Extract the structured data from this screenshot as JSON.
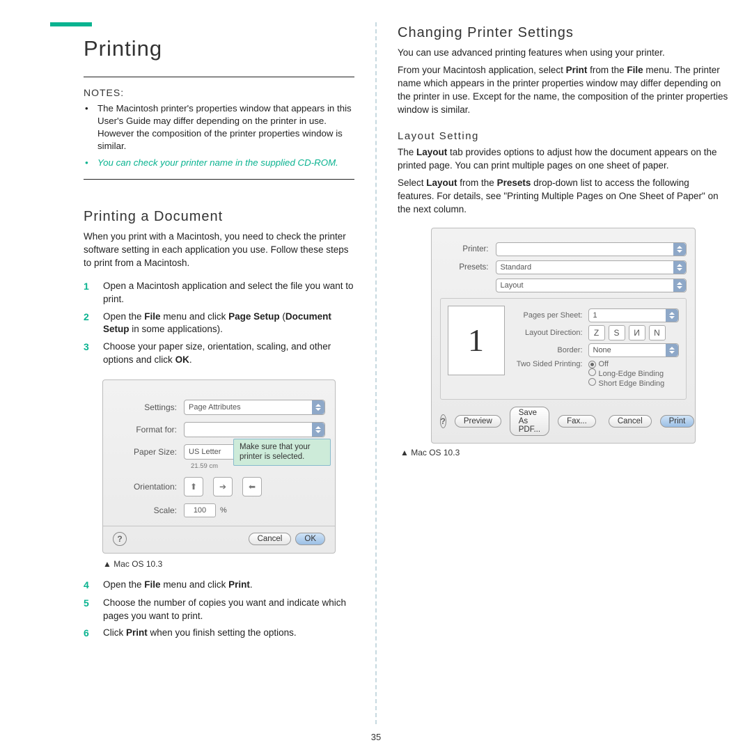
{
  "page_number": "35",
  "left": {
    "heading": "Printing",
    "notes_label": "NOTES:",
    "note1": "The Macintosh printer's properties window that appears in this User's Guide may differ depending on the printer in use. However the composition of the printer properties window is similar.",
    "note2": "You can check your printer name in the supplied CD-ROM.",
    "h2": "Printing a Document",
    "intro": "When you print with a Macintosh, you need to check the printer software setting in each application you use. Follow these steps to print from a Macintosh.",
    "steps": {
      "s1": "Open a Macintosh application and select the file you want to print.",
      "s2a": "Open the ",
      "s2b": "File",
      "s2c": " menu and click ",
      "s2d": "Page Setup",
      "s2e": " (",
      "s2f": "Document Setup",
      "s2g": " in some applications).",
      "s3a": "Choose your paper size, orientation, scaling, and other options and click ",
      "s3b": "OK",
      "s3c": ".",
      "s4a": "Open the ",
      "s4b": "File",
      "s4c": " menu and click ",
      "s4d": "Print",
      "s4e": ".",
      "s5": "Choose the number of copies you want and indicate which pages you want to print.",
      "s6a": "Click ",
      "s6b": "Print",
      "s6c": " when you finish setting the options."
    },
    "dialog1": {
      "settings_lbl": "Settings:",
      "settings_val": "Page Attributes",
      "format_lbl": "Format for:",
      "paper_lbl": "Paper Size:",
      "paper_val": "US Letter",
      "paper_sub": "21.59 cm",
      "orient_lbl": "Orientation:",
      "scale_lbl": "Scale:",
      "scale_val": "100",
      "scale_unit": "%",
      "callout": "Make sure that your printer is selected.",
      "cancel": "Cancel",
      "ok": "OK",
      "help": "?"
    },
    "figcap": "▲ Mac OS 10.3"
  },
  "right": {
    "h2": "Changing Printer Settings",
    "p1": "You can use advanced printing features when using your printer.",
    "p2a": "From your Macintosh application, select ",
    "p2b": "Print",
    "p2c": " from the ",
    "p2d": "File",
    "p2e": " menu. The printer name which appears in the printer properties window may differ depending on the printer in use. Except for the name, the composition of the printer properties window is similar.",
    "h3": "Layout Setting",
    "p3a": "The ",
    "p3b": "Layout",
    "p3c": " tab provides options to adjust how the document appears on the printed page. You can print multiple pages on one sheet of paper.",
    "p4a": "Select ",
    "p4b": "Layout",
    "p4c": " from the ",
    "p4d": "Presets",
    "p4e": " drop-down list to access the following features. For details, see \"Printing Multiple Pages on One Sheet of Paper\" on the next column.",
    "dialog2": {
      "printer_lbl": "Printer:",
      "presets_lbl": "Presets:",
      "presets_val": "Standard",
      "panel_val": "Layout",
      "pps_lbl": "Pages per Sheet:",
      "pps_val": "1",
      "ld_lbl": "Layout Direction:",
      "border_lbl": "Border:",
      "border_val": "None",
      "tsp_lbl": "Two Sided Printing:",
      "tsp_off": "Off",
      "tsp_long": "Long-Edge Binding",
      "tsp_short": "Short Edge Binding",
      "help": "?",
      "preview": "Preview",
      "saveas": "Save As PDF...",
      "fax": "Fax...",
      "cancel": "Cancel",
      "print": "Print",
      "one": "1"
    },
    "figcap": "▲ Mac OS 10.3"
  }
}
